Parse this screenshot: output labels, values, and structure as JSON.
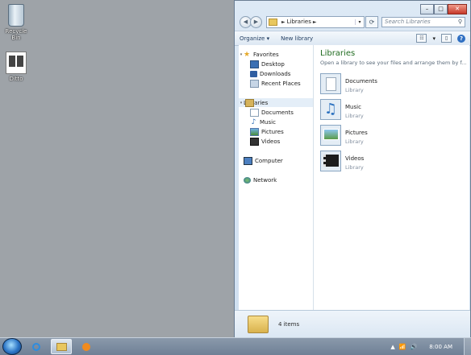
{
  "desktop": {
    "icons": [
      {
        "label": "Recycle Bin",
        "icon": "recycle-bin-icon"
      },
      {
        "label": "Ditto",
        "icon": "ditto-app-icon"
      }
    ]
  },
  "explorer": {
    "caption_buttons": {
      "minimize": "–",
      "maximize": "□",
      "close": "✕"
    },
    "nav": {
      "back": "◀",
      "forward": "▶"
    },
    "address": {
      "crumb": "Libraries",
      "arrow": "►",
      "dropdown": "▾"
    },
    "refresh": "⟳",
    "search": {
      "placeholder": "Search Libraries",
      "glyph": "⚲"
    },
    "toolbar": {
      "organize": "Organize ▾",
      "new_library": "New library",
      "view": "☷",
      "view_drop": "▾",
      "preview": "▯",
      "help": "?"
    },
    "nav_pane": {
      "favorites": "Favorites",
      "favorites_items": [
        "Desktop",
        "Downloads",
        "Recent Places"
      ],
      "libraries": "Libraries",
      "libraries_items": [
        "Documents",
        "Music",
        "Pictures",
        "Videos"
      ],
      "computer": "Computer",
      "network": "Network"
    },
    "content": {
      "title": "Libraries",
      "subtitle": "Open a library to see your files and arrange them by f...",
      "libraries": [
        {
          "name": "Documents",
          "kind": "Library"
        },
        {
          "name": "Music",
          "kind": "Library"
        },
        {
          "name": "Pictures",
          "kind": "Library"
        },
        {
          "name": "Videos",
          "kind": "Library"
        }
      ]
    },
    "details": {
      "count": "4 items"
    }
  },
  "taskbar": {
    "tray_up": "▲",
    "tray_sound": "🔊",
    "clock": "8:00 AM"
  }
}
